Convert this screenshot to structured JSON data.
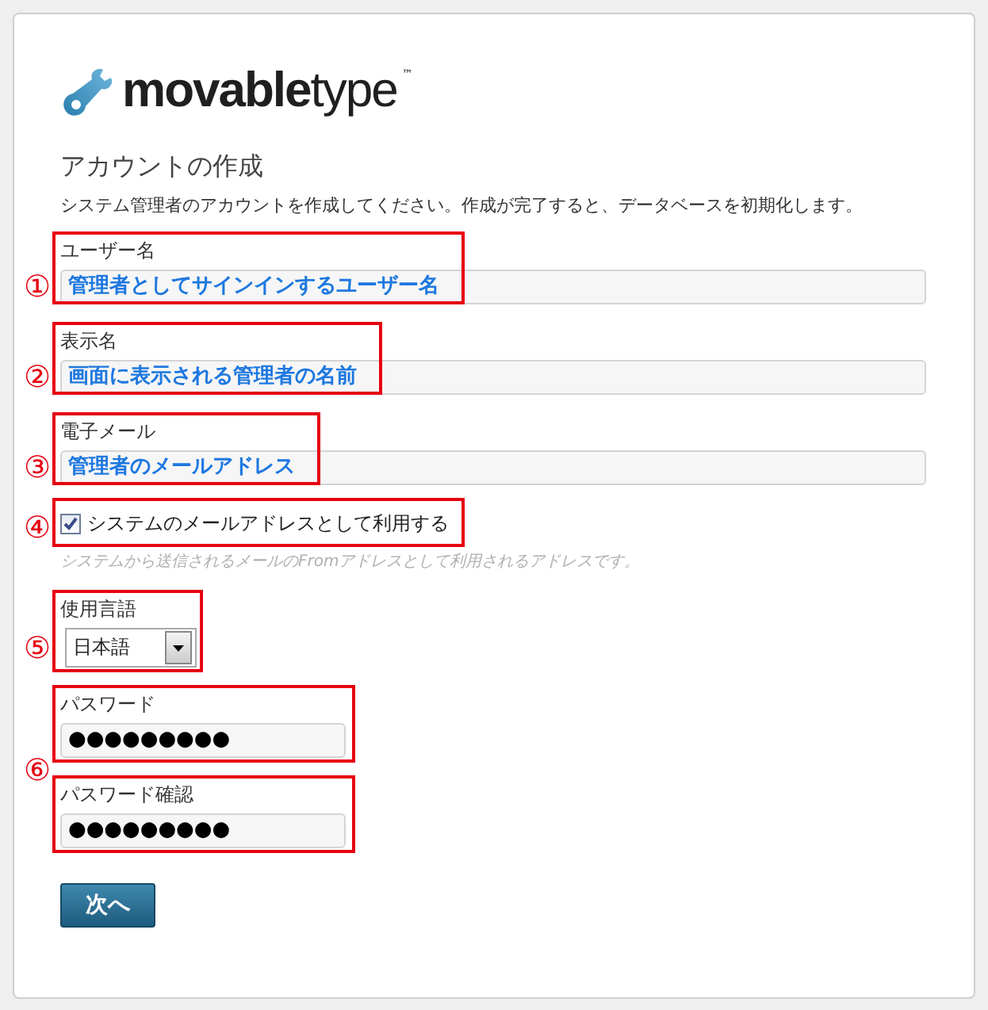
{
  "logo": {
    "text": "**movable**type",
    "trademark": "™"
  },
  "title": "アカウントの作成",
  "description": "システム管理者のアカウントを作成してください。作成が完了すると、データベースを初期化します。",
  "groups": [
    {
      "marker": "①",
      "fields": [
        {
          "kind": "text",
          "label": "ユーザー名",
          "value": "管理者としてサインインするユーザー名"
        }
      ]
    },
    {
      "marker": "②",
      "fields": [
        {
          "kind": "text",
          "label": "表示名",
          "value": "画面に表示される管理者の名前"
        }
      ]
    },
    {
      "marker": "③",
      "fields": [
        {
          "kind": "text",
          "label": "電子メール",
          "value": "管理者のメールアドレス"
        }
      ]
    },
    {
      "marker": "④",
      "fields": [
        {
          "kind": "checkbox",
          "label": "システムのメールアドレスとして利用する",
          "checked": true,
          "hint": "システムから送信されるメールのFromアドレスとして利用されるアドレスです。"
        }
      ]
    },
    {
      "marker": "⑤",
      "fields": [
        {
          "kind": "select",
          "label": "使用言語",
          "value": "日本語"
        }
      ]
    },
    {
      "marker": "⑥",
      "fields": [
        {
          "kind": "password",
          "label": "パスワード",
          "value": "●●●●●●●●●"
        },
        {
          "kind": "password",
          "label": "パスワード確認",
          "value": "●●●●●●●●●"
        }
      ]
    }
  ],
  "button": "次へ"
}
